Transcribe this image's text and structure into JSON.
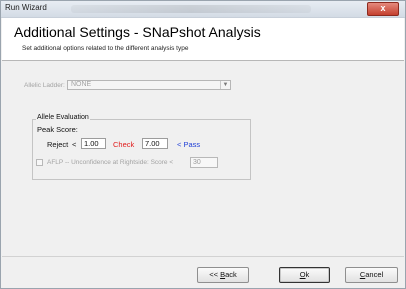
{
  "window": {
    "title": "Run Wizard",
    "close_glyph": "x",
    "close_color": "#c4402f"
  },
  "header": {
    "title": "Additional Settings - SNaPshot Analysis",
    "subtitle": "Set additional options related to the different analysis type"
  },
  "allelic_ladder": {
    "label": "Allelic Ladder:",
    "value": "NONE"
  },
  "allele_evaluation": {
    "group_label": "Allele Evaluation",
    "peak_score_label": "Peak Score:",
    "reject_label": "Reject",
    "reject_op": "<",
    "reject_value": "1.00",
    "check_label": "Check",
    "check_value": "7.00",
    "pass_label": "< Pass",
    "check_color": "#e11b1b",
    "pass_color": "#1f3fd6"
  },
  "aflp": {
    "label": "AFLP -- Unconfidence at Rightside: Score <",
    "value": "30",
    "checked": false
  },
  "footer": {
    "back_prefix": "<< ",
    "back_label_underlined": "B",
    "back_label_rest": "ack",
    "ok_underlined": "O",
    "ok_rest": "k",
    "cancel_underlined": "C",
    "cancel_rest": "ancel"
  }
}
